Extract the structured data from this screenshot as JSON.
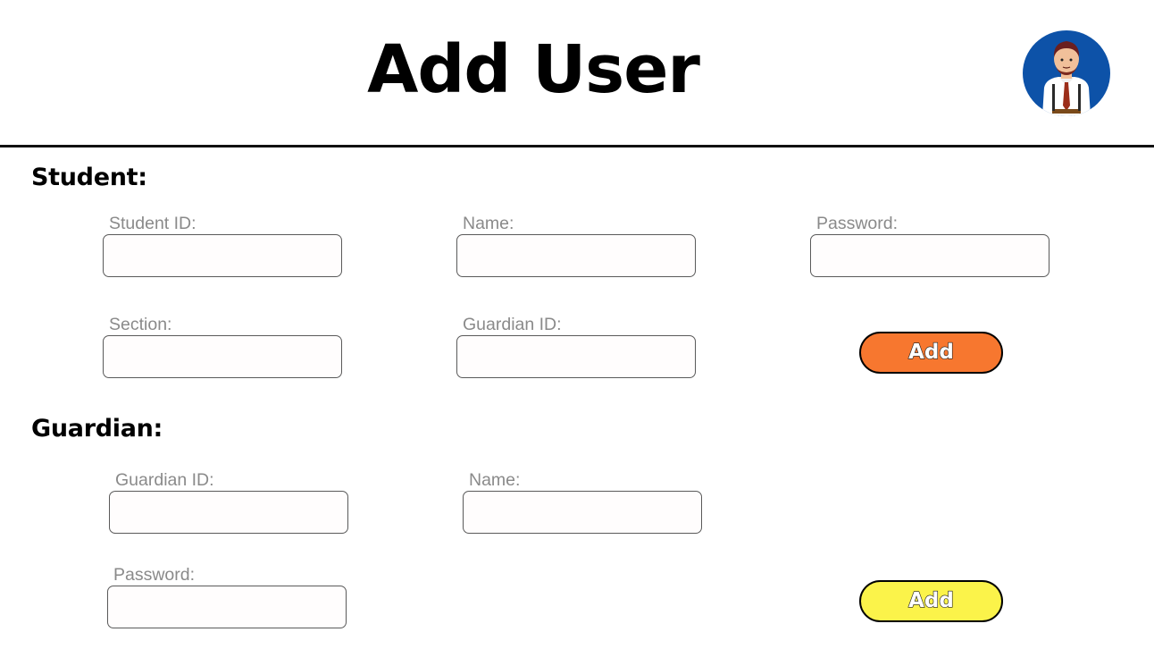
{
  "header": {
    "title": "Add User"
  },
  "student": {
    "heading": "Student:",
    "fields": {
      "student_id": "Student ID:",
      "name": "Name:",
      "password": "Password:",
      "section": "Section:",
      "guardian_id": "Guardian ID:"
    },
    "add_label": "Add",
    "add_color": "#f7772f"
  },
  "guardian": {
    "heading": "Guardian:",
    "fields": {
      "guardian_id": "Guardian ID:",
      "name": "Name:",
      "password": "Password:"
    },
    "add_label": "Add",
    "add_color": "#fbf34a"
  },
  "colors": {
    "avatar_bg": "#0d52a8",
    "divider": "#111111"
  }
}
